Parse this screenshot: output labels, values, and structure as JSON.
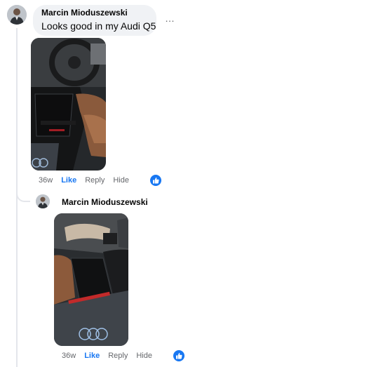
{
  "comment": {
    "author": "Marcin Mioduszewski",
    "text": "Looks good in my Audi Q5",
    "more_icon": "…",
    "actions": {
      "time": "36w",
      "like": "Like",
      "reply": "Reply",
      "hide": "Hide"
    }
  },
  "reply": {
    "author": "Marcin Mioduszewski",
    "actions": {
      "time": "36w",
      "like": "Like",
      "reply": "Reply",
      "hide": "Hide"
    }
  },
  "colors": {
    "accent": "#1877f2",
    "bubble": "#f0f2f5",
    "muted": "#65676b",
    "thread": "#e4e6eb"
  },
  "icons": {
    "like_badge": "thumbs-up-icon",
    "more": "more-options-icon"
  }
}
